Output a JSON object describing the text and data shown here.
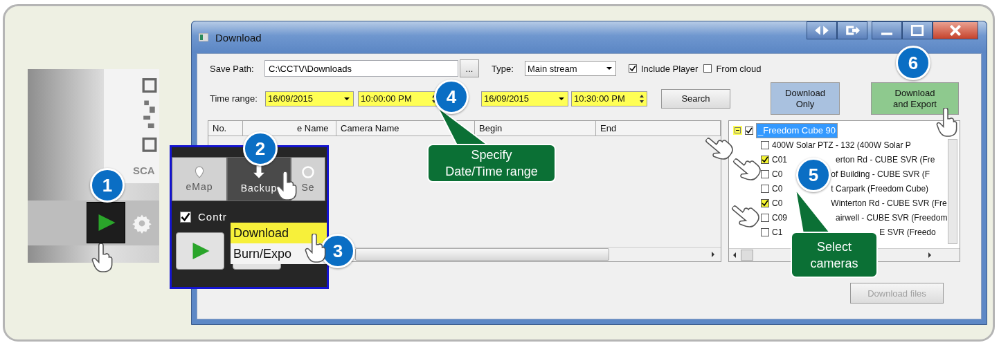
{
  "left_screen": {
    "scan_label": "SCA"
  },
  "inset": {
    "tabs": [
      {
        "label": "eMap",
        "selected": false
      },
      {
        "label": "Backup",
        "selected": true
      },
      {
        "label": "Se",
        "selected": false
      }
    ],
    "control_checkbox": {
      "label": "Contr",
      "checked": true
    },
    "menu": [
      {
        "label": "Download",
        "selected": true
      },
      {
        "label": "Burn/Expo",
        "selected": false
      }
    ]
  },
  "window": {
    "title": "Download"
  },
  "form": {
    "save_path_label": "Save Path:",
    "save_path": "C:\\CCTV\\Downloads",
    "browse_button": "...",
    "type_label": "Type:",
    "type_value": "Main stream",
    "include_player": {
      "label": "Include Player",
      "checked": true
    },
    "from_cloud": {
      "label": "From cloud",
      "checked": false
    },
    "time_range_label": "Time range:",
    "start_date": "16/09/2015",
    "start_time": "10:00:00 PM",
    "end_date": "16/09/2015",
    "end_time": "10:30:00 PM",
    "search_button": "Search",
    "download_only_button": "Download\nOnly",
    "download_export_button": "Download\nand Export"
  },
  "table": {
    "columns": [
      "No.",
      "e Name",
      "Camera Name",
      "Begin",
      "End"
    ]
  },
  "tree": {
    "root": {
      "label": "_Freedom Cube 90",
      "checked": true,
      "expanded": true,
      "selected": true
    },
    "children": [
      {
        "parts": [
          "400W Solar PTZ - 132 (400W Solar P"
        ],
        "checked": false
      },
      {
        "parts": [
          "C01",
          "erton Rd - CUBE SVR (Fre"
        ],
        "checked": true
      },
      {
        "parts": [
          "C0",
          "of Building - CUBE SVR (F"
        ],
        "checked": false
      },
      {
        "parts": [
          "C0",
          "t Carpark (Freedom Cube)"
        ],
        "checked": false
      },
      {
        "parts": [
          "C0",
          "Winterton Rd - CUBE SVR (Fre"
        ],
        "checked": true
      },
      {
        "parts": [
          "C09",
          "airwell - CUBE SVR (Freedom"
        ],
        "checked": false
      },
      {
        "parts": [
          "C1",
          "E SVR (Freedo"
        ],
        "checked": false
      }
    ]
  },
  "download_files_button": {
    "label": "Download files",
    "disabled": true
  },
  "steps": [
    {
      "number": "1"
    },
    {
      "number": "2"
    },
    {
      "number": "3"
    },
    {
      "number": "4"
    },
    {
      "number": "5"
    },
    {
      "number": "6"
    }
  ],
  "callouts": [
    {
      "text": "Specify\nDate/Time range"
    },
    {
      "text": "Select\ncameras"
    }
  ]
}
